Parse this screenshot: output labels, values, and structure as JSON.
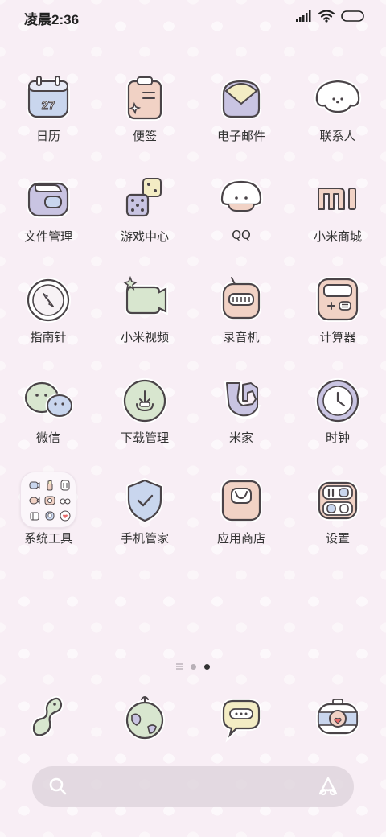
{
  "status_bar": {
    "time": "凌晨2:36"
  },
  "apps": [
    {
      "label": "日历",
      "icon": "calendar-icon",
      "day": "27"
    },
    {
      "label": "便签",
      "icon": "notes-icon"
    },
    {
      "label": "电子邮件",
      "icon": "email-icon"
    },
    {
      "label": "联系人",
      "icon": "contacts-icon"
    },
    {
      "label": "文件管理",
      "icon": "file-manager-icon"
    },
    {
      "label": "游戏中心",
      "icon": "game-center-icon"
    },
    {
      "label": "QQ",
      "icon": "qq-icon"
    },
    {
      "label": "小米商城",
      "icon": "mi-store-icon"
    },
    {
      "label": "指南针",
      "icon": "compass-icon"
    },
    {
      "label": "小米视频",
      "icon": "video-icon"
    },
    {
      "label": "录音机",
      "icon": "recorder-icon"
    },
    {
      "label": "计算器",
      "icon": "calculator-icon"
    },
    {
      "label": "微信",
      "icon": "wechat-icon"
    },
    {
      "label": "下载管理",
      "icon": "download-icon"
    },
    {
      "label": "米家",
      "icon": "mijia-icon"
    },
    {
      "label": "时钟",
      "icon": "clock-icon"
    },
    {
      "label": "系统工具",
      "icon": "system-tools-folder-icon"
    },
    {
      "label": "手机管家",
      "icon": "security-icon"
    },
    {
      "label": "应用商店",
      "icon": "app-store-icon"
    },
    {
      "label": "设置",
      "icon": "settings-icon"
    }
  ],
  "page_indicator": {
    "pages": 3,
    "current": 3
  },
  "dock": [
    {
      "icon": "phone-icon"
    },
    {
      "icon": "browser-icon"
    },
    {
      "icon": "messages-icon"
    },
    {
      "icon": "camera-icon"
    }
  ],
  "search": {
    "left_icon": "search-icon",
    "right_icon": "assistant-icon"
  },
  "colors": {
    "background": "#f8eef5",
    "outline": "#4a4448",
    "blue": "#c9d6ee",
    "peach": "#f1d2c5",
    "green": "#d8e6cf",
    "purple": "#c9c4e2"
  }
}
